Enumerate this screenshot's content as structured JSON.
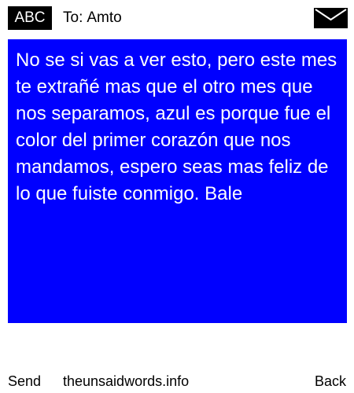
{
  "header": {
    "mode_label": "ABC",
    "to_label": "To:",
    "recipient": "Amto",
    "icon": "envelope-icon"
  },
  "message": {
    "text": "No se si vas a ver esto, pero este mes te extrañé mas que el otro mes que nos separamos, azul es porque fue el color del primer corazón que nos mandamos, espero seas mas feliz de lo que fuiste conmigo. Bale",
    "background_color": "#0000ff",
    "text_color": "#ffffff"
  },
  "footer": {
    "send_label": "Send",
    "site_label": "theunsaidwords.info",
    "back_label": "Back"
  }
}
